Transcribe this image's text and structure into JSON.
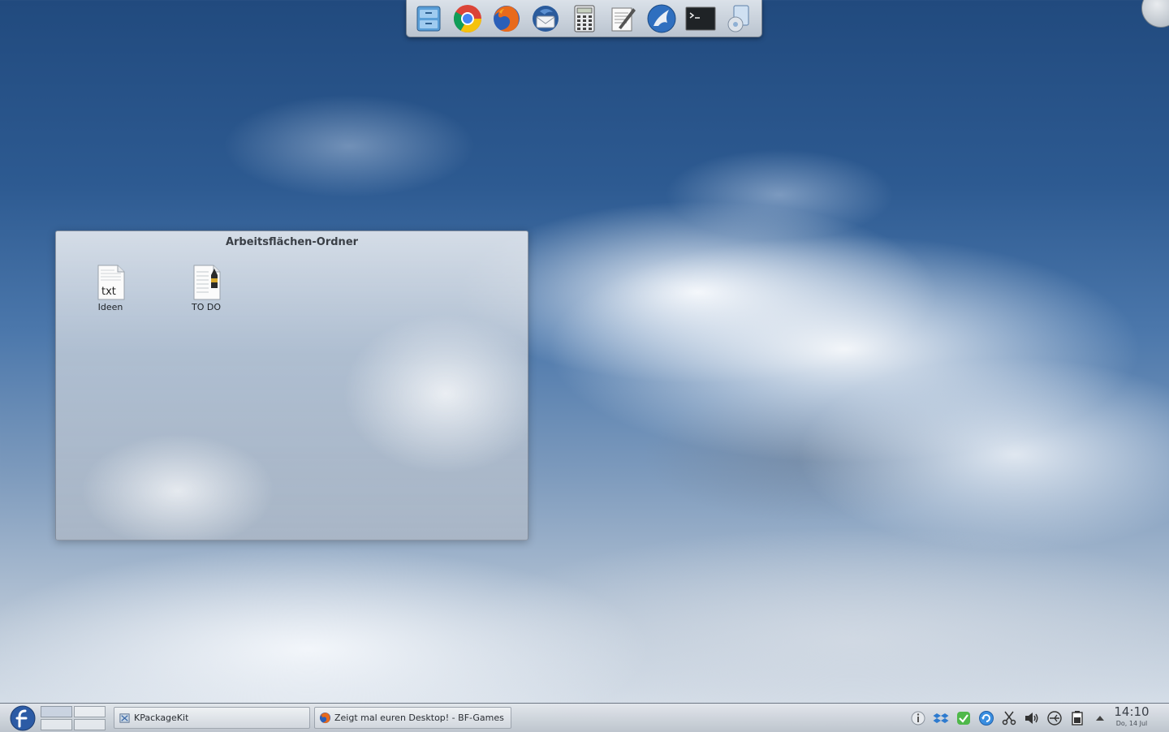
{
  "dock": {
    "apps": [
      {
        "name": "file-manager",
        "icon": "file-cabinet-icon"
      },
      {
        "name": "chrome",
        "icon": "chrome-icon"
      },
      {
        "name": "firefox",
        "icon": "firefox-icon"
      },
      {
        "name": "thunderbird",
        "icon": "thunderbird-icon"
      },
      {
        "name": "calculator",
        "icon": "calculator-icon"
      },
      {
        "name": "text-editor",
        "icon": "text-editor-icon"
      },
      {
        "name": "music-player",
        "icon": "amarok-wolf-icon"
      },
      {
        "name": "terminal",
        "icon": "terminal-icon"
      },
      {
        "name": "media-player",
        "icon": "media-player-icon"
      }
    ]
  },
  "folder_view": {
    "title": "Arbeitsflächen-Ordner",
    "files": [
      {
        "label": "Ideen",
        "icon": "text-file-icon",
        "badge": "txt"
      },
      {
        "label": "TO DO",
        "icon": "todo-document-icon"
      }
    ]
  },
  "taskbar": {
    "tasks": [
      {
        "label": "KPackageKit",
        "icon": "kpackagekit-icon"
      },
      {
        "label": "Zeigt mal euren Desktop! - BF-Games",
        "icon": "firefox-icon"
      }
    ],
    "tray": [
      "info-icon",
      "dropbox-icon",
      "checkmark-shield-icon",
      "update-icon",
      "scissors-icon",
      "volume-icon",
      "usb-icon",
      "battery-icon",
      "expand-arrow-icon"
    ],
    "clock": {
      "time": "14:10",
      "date": "Do, 14 Jul"
    }
  },
  "colors": {
    "sky": "#2d5a91",
    "panel": "#d6dbe1"
  }
}
